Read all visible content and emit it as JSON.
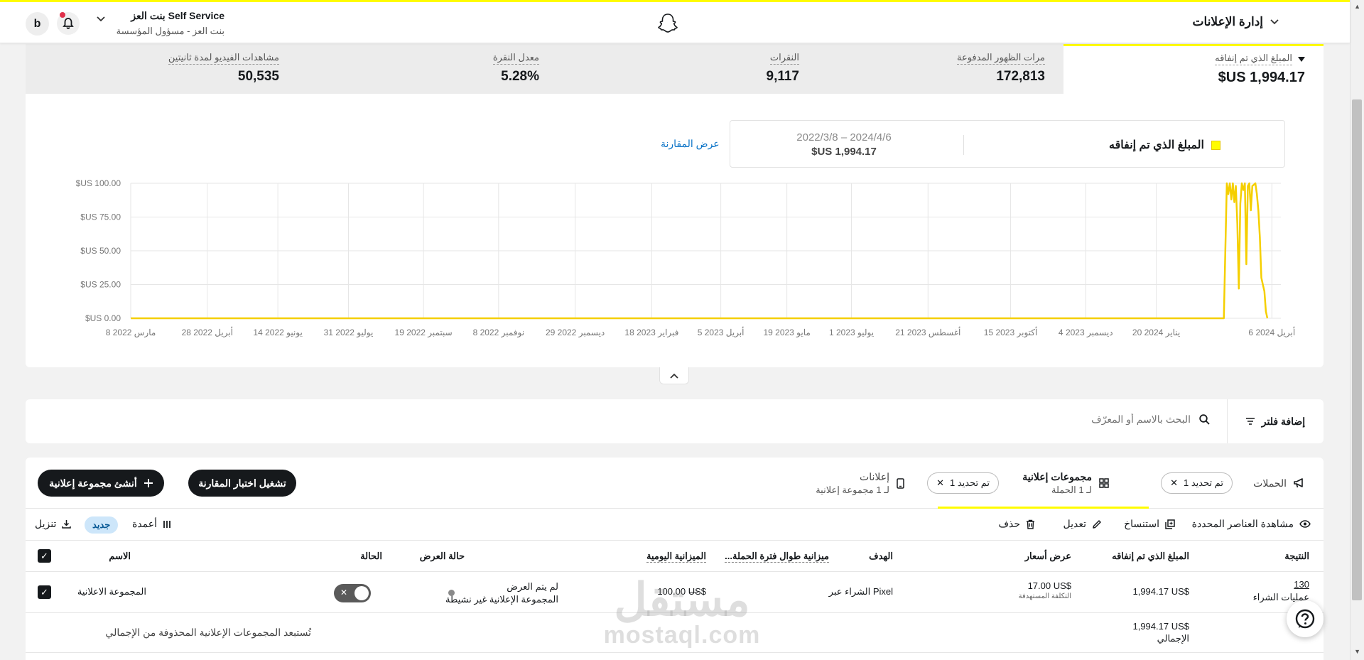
{
  "header": {
    "nav_label": "إدارة الإعلانات",
    "user_name": "بنت العز Self Service",
    "user_role": "بنت العز - مسؤول المؤسسة",
    "avatar_letter": "b"
  },
  "metrics": [
    {
      "label": "المبلغ الذي تم إنفاقه",
      "value": "$US 1,994.17"
    },
    {
      "label": "مرات الظهور المدفوعة",
      "value": "172,813"
    },
    {
      "label": "النقرات",
      "value": "9,117"
    },
    {
      "label": "معدل النقرة",
      "value": "5.28%"
    },
    {
      "label": "مشاهدات الفيديو لمدة ثانيتين",
      "value": "50,535"
    }
  ],
  "legend": {
    "series_label": "المبلغ الذي تم إنفاقه",
    "date_range": "2022/3/8 – 2024/4/6",
    "amount": "$US 1,994.17",
    "compare_link": "عرض المقارنة"
  },
  "chart_data": {
    "type": "line",
    "y_ticks": [
      "$US 0.00",
      "$US 25.00",
      "$US 50.00",
      "$US 75.00",
      "$US 100.00"
    ],
    "ylim": [
      0,
      100
    ],
    "x_ticks": [
      "8 مارس 2022",
      "28 أبريل 2022",
      "14 يونيو 2022",
      "31 يوليو 2022",
      "19 سبتمبر 2022",
      "8 نوفمبر 2022",
      "29 ديسمبر 2022",
      "18 فبراير 2023",
      "5 أبريل 2023",
      "19 مايو 2023",
      "1 يوليو 2023",
      "21 أغسطس 2023",
      "15 أكتوبر 2023",
      "4 ديسمبر 2023",
      "20 يناير 2024",
      "6 أبريل 2024"
    ],
    "x_tick_dates": [
      "2022-03-08",
      "2022-04-28",
      "2022-06-14",
      "2022-07-31",
      "2022-09-19",
      "2022-11-08",
      "2022-12-29",
      "2023-02-18",
      "2023-04-05",
      "2023-05-19",
      "2023-07-01",
      "2023-08-21",
      "2023-10-15",
      "2023-12-04",
      "2024-01-20",
      "2024-04-06"
    ],
    "xlim": [
      "2022-03-08",
      "2024-04-12"
    ],
    "grid": true,
    "color": "#f5cf00",
    "series": [
      {
        "points": [
          [
            "2022-03-08",
            0
          ],
          [
            "2024-03-05",
            0
          ],
          [
            "2024-03-07",
            100
          ],
          [
            "2024-03-08",
            92
          ],
          [
            "2024-03-09",
            100
          ],
          [
            "2024-03-10",
            88
          ],
          [
            "2024-03-11",
            100
          ],
          [
            "2024-03-12",
            86
          ],
          [
            "2024-03-13",
            98
          ],
          [
            "2024-03-14",
            70
          ],
          [
            "2024-03-15",
            22
          ],
          [
            "2024-03-16",
            85
          ],
          [
            "2024-03-17",
            100
          ],
          [
            "2024-03-18",
            95
          ],
          [
            "2024-03-19",
            100
          ],
          [
            "2024-03-20",
            40
          ],
          [
            "2024-03-21",
            98
          ],
          [
            "2024-03-22",
            100
          ],
          [
            "2024-03-23",
            80
          ],
          [
            "2024-03-24",
            98
          ],
          [
            "2024-03-25",
            99
          ],
          [
            "2024-03-26",
            100
          ],
          [
            "2024-03-27",
            92
          ],
          [
            "2024-03-28",
            80
          ],
          [
            "2024-03-29",
            60
          ],
          [
            "2024-03-30",
            30
          ],
          [
            "2024-03-31",
            25
          ],
          [
            "2024-04-01",
            20
          ],
          [
            "2024-04-02",
            5
          ],
          [
            "2024-04-03",
            0
          ]
        ]
      }
    ]
  },
  "filter": {
    "add_filter": "إضافة فلتر",
    "search_placeholder": "البحث بالاسم أو المعرّف"
  },
  "tabs": {
    "campaigns": "الحملات",
    "campaigns_chip": "تم تحديد 1",
    "adsets_title": "مجموعات إعلانية",
    "adsets_sub": "لـ 1 الحملة",
    "adsets_chip": "تم تحديد 1",
    "ads_title": "إعلانات",
    "ads_sub": "لـ 1 مجموعة إعلانية",
    "run_test": "تشغيل اختبار المقارنة",
    "create_adset": "أنشئ مجموعة إعلانية"
  },
  "toolbar": {
    "view_selected": "مشاهدة العناصر المحددة",
    "duplicate": "استنساخ",
    "edit": "تعديل",
    "delete": "حذف",
    "columns": "أعمدة",
    "new_badge": "جديد",
    "download": "تنزيل"
  },
  "table": {
    "headers": {
      "result": "النتيجة",
      "spend": "المبلغ الذي تم إنفاقه",
      "bid": "عرض أسعار",
      "goal": "الهدف",
      "lifetime_budget": "...ميزانية طوال فترة الحملة",
      "daily_budget": "الميزانية اليومية",
      "delivery": "حالة العرض",
      "status": "الحالة",
      "name": "الاسم"
    },
    "row": {
      "result_value": "130",
      "result_label": "عمليات الشراء",
      "spend": "1,994.17 US$",
      "bid": "17.00 US$",
      "bid_sub": "التكلفة المستهدفة",
      "goal": "الشراء عبر Pixel",
      "lifetime_budget": "—",
      "daily_budget": "100.00 US$",
      "delivery_main": "لم يتم العرض",
      "delivery_sub": "المجموعة الإعلانية غير نشيطة",
      "name": "المجموعة الاعلانية"
    },
    "total": {
      "note": "تُستبعد المجموعات الإعلانية المحذوفة من الإجمالي",
      "spend": "1,994.17 US$",
      "label": "الإجمالي"
    }
  },
  "watermark": {
    "arabic": "مستقل",
    "latin": "mostaql.com"
  }
}
